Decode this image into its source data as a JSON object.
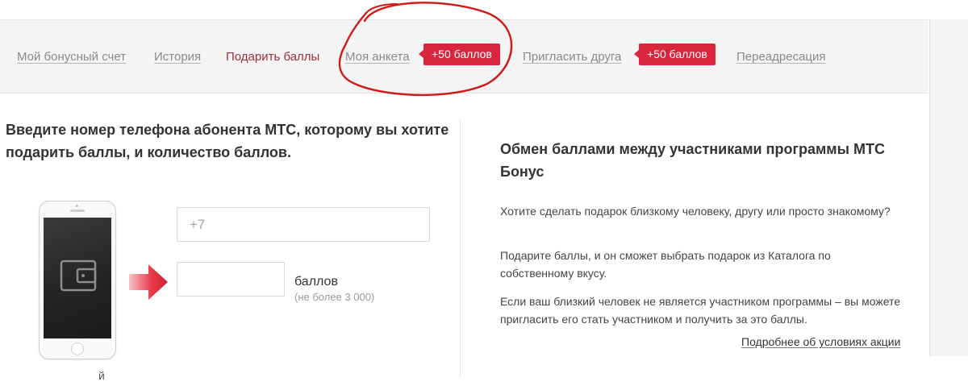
{
  "nav": {
    "items": [
      {
        "label": "Мой бонусный счет",
        "active": false
      },
      {
        "label": "История",
        "active": false
      },
      {
        "label": "Подарить баллы",
        "active": true
      },
      {
        "label": "Моя анкета",
        "active": false
      },
      {
        "label": "Пригласить друга",
        "active": false
      },
      {
        "label": "Переадресация",
        "active": false
      }
    ],
    "badges": [
      "+50 баллов",
      "+50 баллов"
    ]
  },
  "gift_form": {
    "title": "Введите номер телефона абонента МТС, которому вы хотите подарить баллы, и количество баллов.",
    "phone_placeholder": "+7",
    "points_value": "",
    "points_label": "баллов",
    "points_limit": "(не более 3 000)",
    "cut_off_text": "й"
  },
  "info": {
    "title": "Обмен баллами между участниками программы МТС Бонус",
    "paragraphs": [
      "Хотите сделать подарок близкому человеку, другу или просто знакомому?",
      "Подарите баллы, и он сможет выбрать подарок из Каталога по собственному вкусу.",
      "Если ваш близкий человек не является участником программы – вы можете пригласить его стать участником и получить за это баллы."
    ],
    "details_link": "Подробнее об условиях акции"
  },
  "colors": {
    "accent_red": "#d7263d",
    "active_tab": "#9b2f3a",
    "annotation": "#d01818"
  },
  "icons": {
    "phone_screen": "wallet-icon",
    "arrow": "red-arrow-right-icon"
  }
}
